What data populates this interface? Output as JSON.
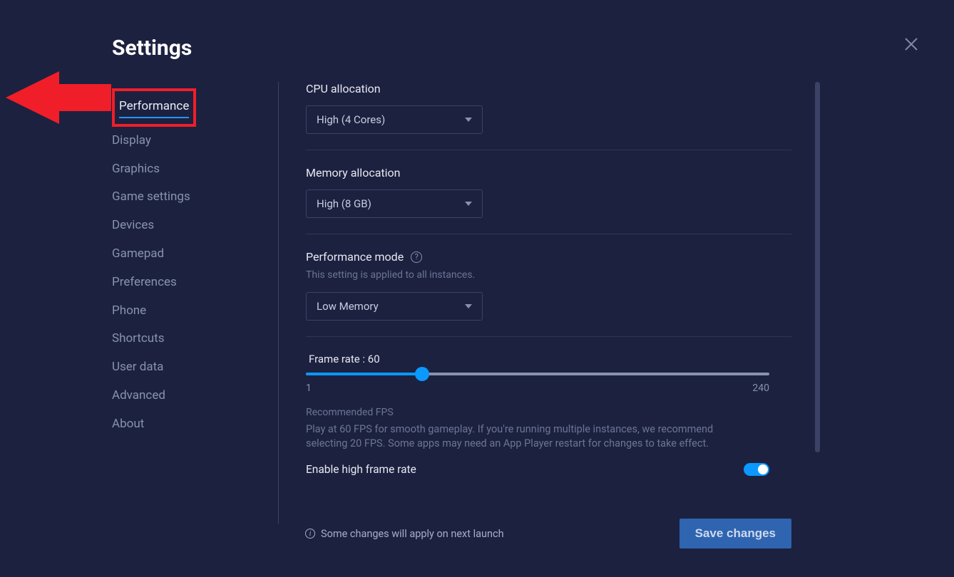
{
  "title": "Settings",
  "sidebar": {
    "items": [
      {
        "label": "Performance",
        "active": true
      },
      {
        "label": "Display"
      },
      {
        "label": "Graphics"
      },
      {
        "label": "Game settings"
      },
      {
        "label": "Devices"
      },
      {
        "label": "Gamepad"
      },
      {
        "label": "Preferences"
      },
      {
        "label": "Phone"
      },
      {
        "label": "Shortcuts"
      },
      {
        "label": "User data"
      },
      {
        "label": "Advanced"
      },
      {
        "label": "About"
      }
    ]
  },
  "cpu": {
    "label": "CPU allocation",
    "value": "High (4 Cores)"
  },
  "memory": {
    "label": "Memory allocation",
    "value": "High (8 GB)"
  },
  "perfmode": {
    "label": "Performance mode",
    "subtext": "This setting is applied to all instances.",
    "value": "Low Memory"
  },
  "framerate": {
    "label_prefix": "Frame rate : ",
    "value": "60",
    "min": "1",
    "max": "240",
    "percent": 25,
    "rec_label": "Recommended FPS",
    "rec_text": "Play at 60 FPS for smooth gameplay. If you're running multiple instances, we recommend selecting 20 FPS. Some apps may need an App Player restart for changes to take effect.",
    "high_fps_label": "Enable high frame rate",
    "high_fps_on": true
  },
  "footer": {
    "notice": "Some changes will apply on next launch",
    "save": "Save changes"
  }
}
